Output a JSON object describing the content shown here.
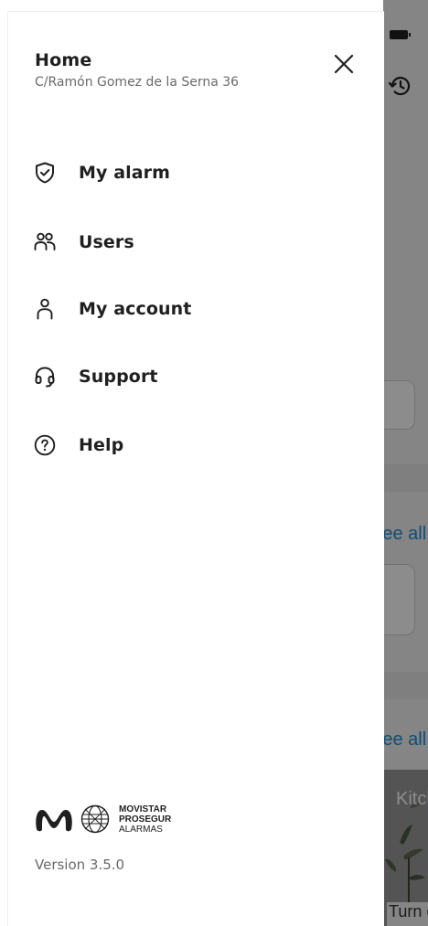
{
  "drawer": {
    "title": "Home",
    "address": "C/Ramón Gomez de la Serna 36",
    "close_icon": "close-icon",
    "menu": [
      {
        "label": "My alarm",
        "icon": "shield-check-icon"
      },
      {
        "label": "Users",
        "icon": "users-icon"
      },
      {
        "label": "My account",
        "icon": "person-icon"
      },
      {
        "label": "Support",
        "icon": "headset-icon"
      },
      {
        "label": "Help",
        "icon": "help-circle-icon"
      }
    ],
    "brand": {
      "line1": "MOVISTAR",
      "line2": "PROSEGUR",
      "line3": "ALARMAS"
    },
    "version": "Version 3.5.0"
  },
  "background": {
    "see_all_1": "See all",
    "see_all_2": "See all",
    "photo_title": "Kitchen",
    "photo_caption": "Turn on",
    "link_color": "#1a8fd6"
  },
  "colors": {
    "text_primary": "#1f1f1f",
    "text_secondary": "#6a6a6a",
    "overlay": "rgba(0,0,0,0.45)"
  }
}
